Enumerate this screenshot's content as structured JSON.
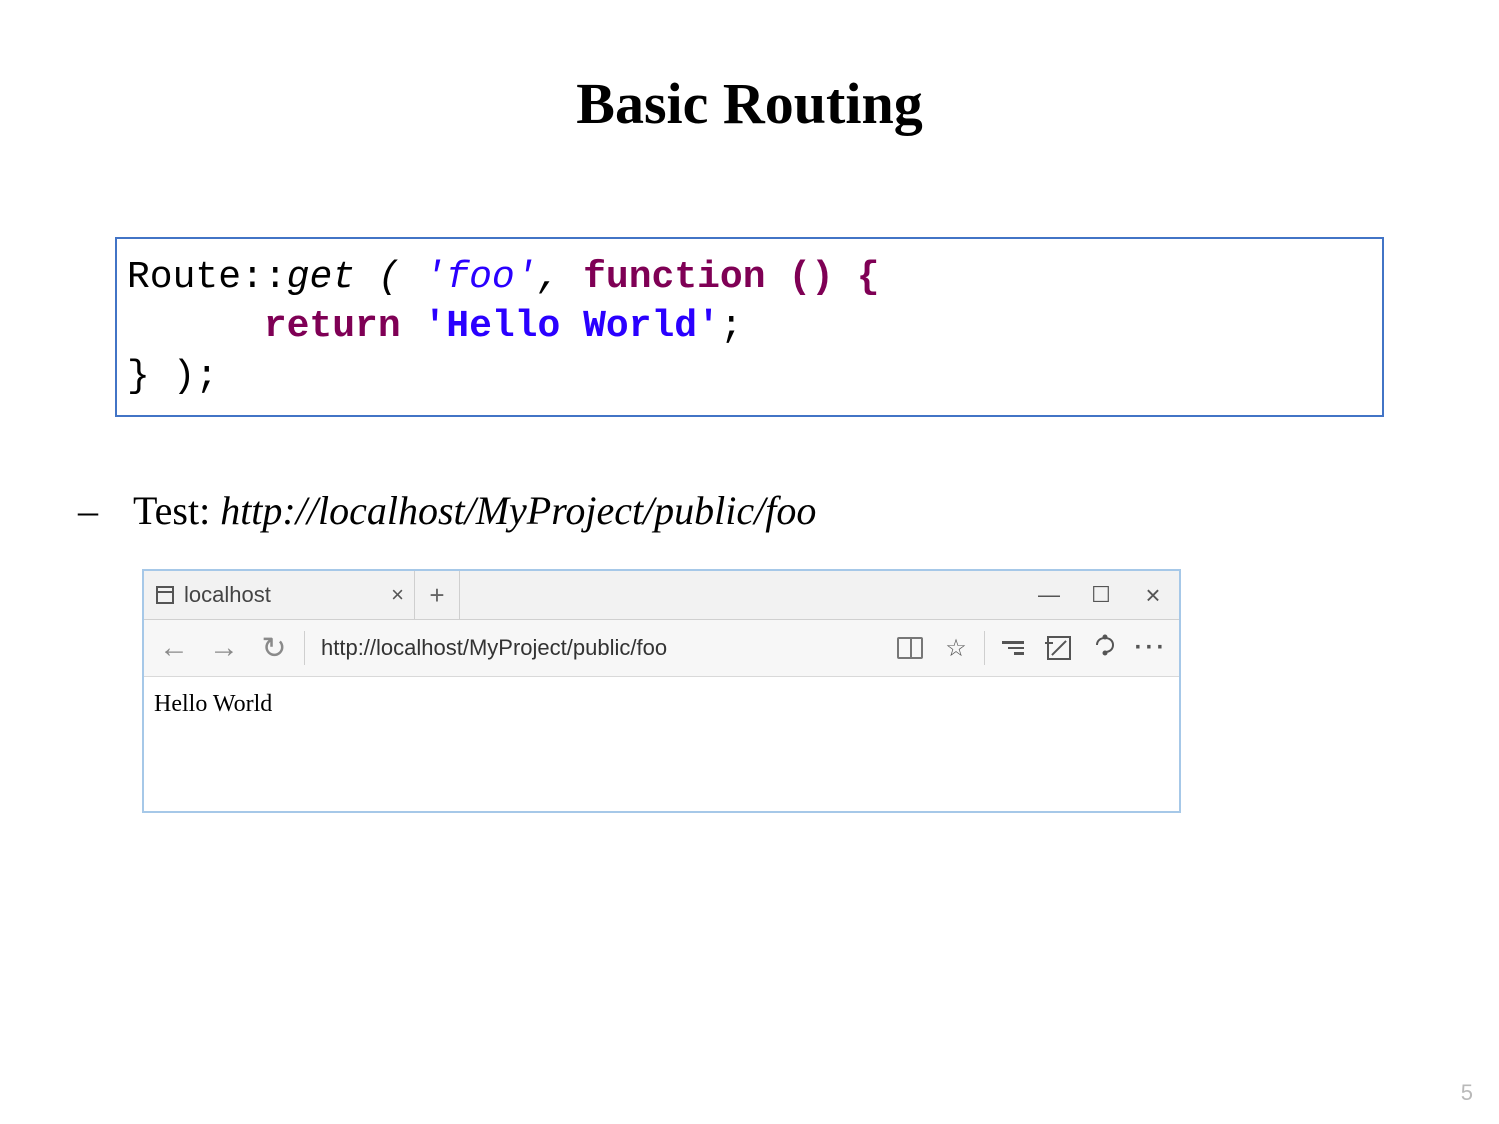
{
  "title": "Basic Routing",
  "code": {
    "l1_class": "Route::",
    "l1_get": "get ( ",
    "l1_str": "'foo'",
    "l1_comma": ", ",
    "l1_func": "function () {",
    "l2_indent": "      ",
    "l2_return": "return ",
    "l2_str": "'Hello World'",
    "l2_semi": ";",
    "l3": "} );"
  },
  "bullet": {
    "dash": "–",
    "label": "Test: ",
    "url": "http://localhost/MyProject/public/foo"
  },
  "browser": {
    "tab_title": "localhost",
    "tab_close": "×",
    "plus": "+",
    "win_min": "—",
    "win_max": "☐",
    "win_close": "×",
    "nav_back": "←",
    "nav_fwd": "→",
    "nav_refresh": "↻",
    "url": "http://localhost/MyProject/public/foo",
    "star": "☆",
    "more": "···",
    "body": "Hello World"
  },
  "slide_number": "5"
}
